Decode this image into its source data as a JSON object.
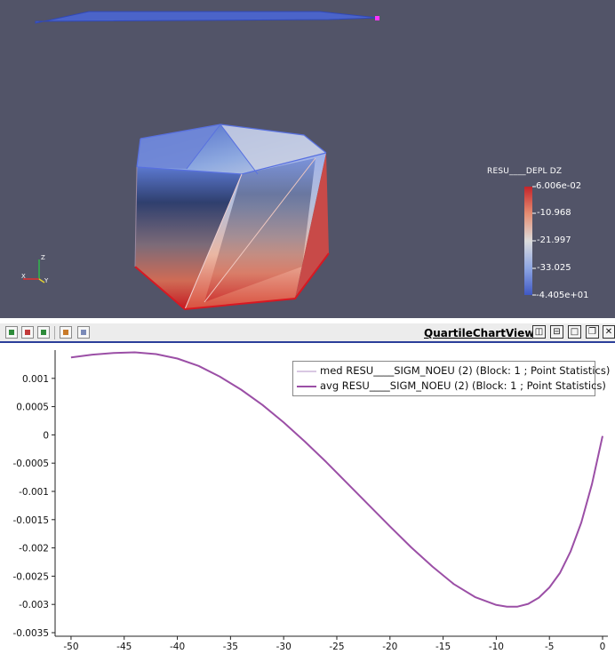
{
  "render_view": {
    "colorbar": {
      "title": "RESU____DEPL DZ",
      "labels": [
        "6.006e-02",
        "-10.968",
        "-21.997",
        "-33.025",
        "-4.405e+01"
      ]
    },
    "axes_labels": {
      "x": "X",
      "y": "Y",
      "z": "Z"
    }
  },
  "toolbar": {
    "buttons": [
      "select-cells-icon",
      "select-points-icon",
      "select-block-icon",
      "frustum-select-icon",
      "clear-selection-icon"
    ],
    "view_title": "QuartileChartView1",
    "window_buttons": [
      "split-horizontal",
      "split-vertical",
      "maximize",
      "restore",
      "close"
    ]
  },
  "chart_data": {
    "type": "line",
    "xlim": [
      -51.5,
      0.5
    ],
    "ylim": [
      -0.0035,
      0.0015
    ],
    "xticks": [
      -50,
      -45,
      -40,
      -35,
      -30,
      -25,
      -20,
      -15,
      -10,
      -5,
      0
    ],
    "yticks": [
      0.001,
      0.0005,
      0,
      -0.0005,
      -0.001,
      -0.0015,
      -0.002,
      -0.0025,
      -0.003,
      -0.0035
    ],
    "ytick_labels": [
      "0.001",
      "0.0005",
      "0",
      "-0.0005",
      "-0.001",
      "-0.0015",
      "-0.002",
      "-0.0025",
      "-0.003",
      "-0.0035"
    ],
    "legend_position": "top-right",
    "series": [
      {
        "name": "med RESU____SIGM_NOEU (2) (Block: 1 ; Point Statistics)",
        "color": "#d9c8e3",
        "x": [],
        "y": []
      },
      {
        "name": "avg RESU____SIGM_NOEU (2) (Block: 1 ; Point Statistics)",
        "color": "#9b4fa6",
        "x": [
          -50,
          -48,
          -46,
          -44,
          -42,
          -40,
          -38,
          -36,
          -34,
          -32,
          -30,
          -28,
          -26,
          -24,
          -22,
          -20,
          -18,
          -16,
          -14,
          -12,
          -10,
          -9,
          -8,
          -7,
          -6,
          -5,
          -4,
          -3,
          -2,
          -1,
          0
        ],
        "y": [
          0.00137,
          0.00142,
          0.00145,
          0.00146,
          0.00143,
          0.00135,
          0.00122,
          0.00103,
          0.0008,
          0.00053,
          0.00022,
          -0.00012,
          -0.00048,
          -0.00086,
          -0.00124,
          -0.00162,
          -0.00199,
          -0.00233,
          -0.00264,
          -0.00287,
          -0.00301,
          -0.00304,
          -0.00304,
          -0.00299,
          -0.00288,
          -0.0027,
          -0.00244,
          -0.00206,
          -0.00155,
          -0.00087,
          -2e-05
        ]
      }
    ]
  }
}
